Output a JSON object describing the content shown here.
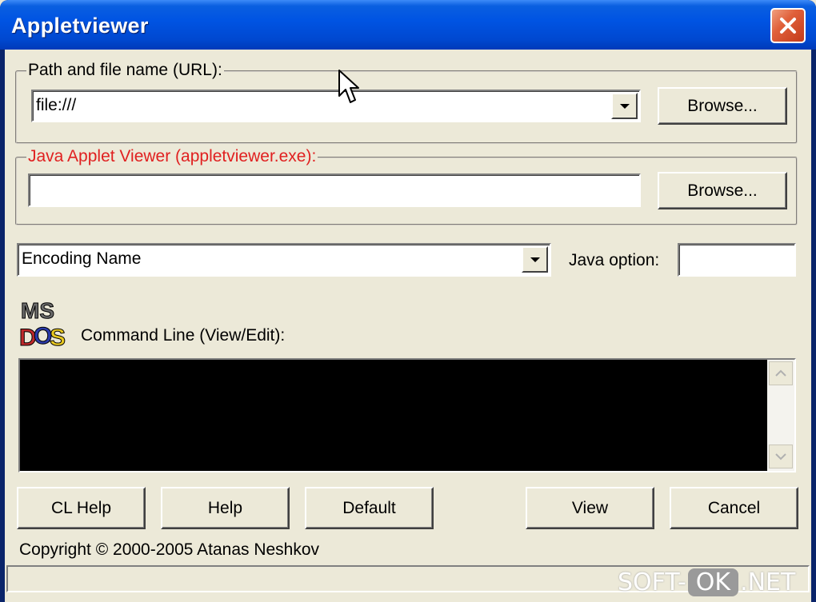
{
  "window": {
    "title": "Appletviewer"
  },
  "path_group": {
    "legend": "Path and file name (URL):",
    "url_value": "file:///",
    "browse_label": "Browse..."
  },
  "viewer_group": {
    "legend": "Java Applet Viewer (appletviewer.exe):",
    "viewer_value": "",
    "browse_label": "Browse...",
    "legend_color": "#e02020"
  },
  "encoding": {
    "selected": "Encoding Name",
    "java_option_label": "Java option:",
    "java_option_value": ""
  },
  "command_line": {
    "label": "Command Line (View/Edit):",
    "icon": "ms-dos-icon",
    "console_text": ""
  },
  "buttons": {
    "cl_help": "CL Help",
    "help": "Help",
    "default": "Default",
    "view": "View",
    "cancel": "Cancel"
  },
  "footer": {
    "copyright": "Copyright © 2000-2005 Atanas Neshkov",
    "status_text": ""
  },
  "watermark": {
    "left": "SOFT-",
    "ok": "OK",
    "right": ".NET"
  },
  "colors": {
    "titlebar": "#0054e3",
    "face": "#ece9d8",
    "console_bg": "#000000"
  }
}
